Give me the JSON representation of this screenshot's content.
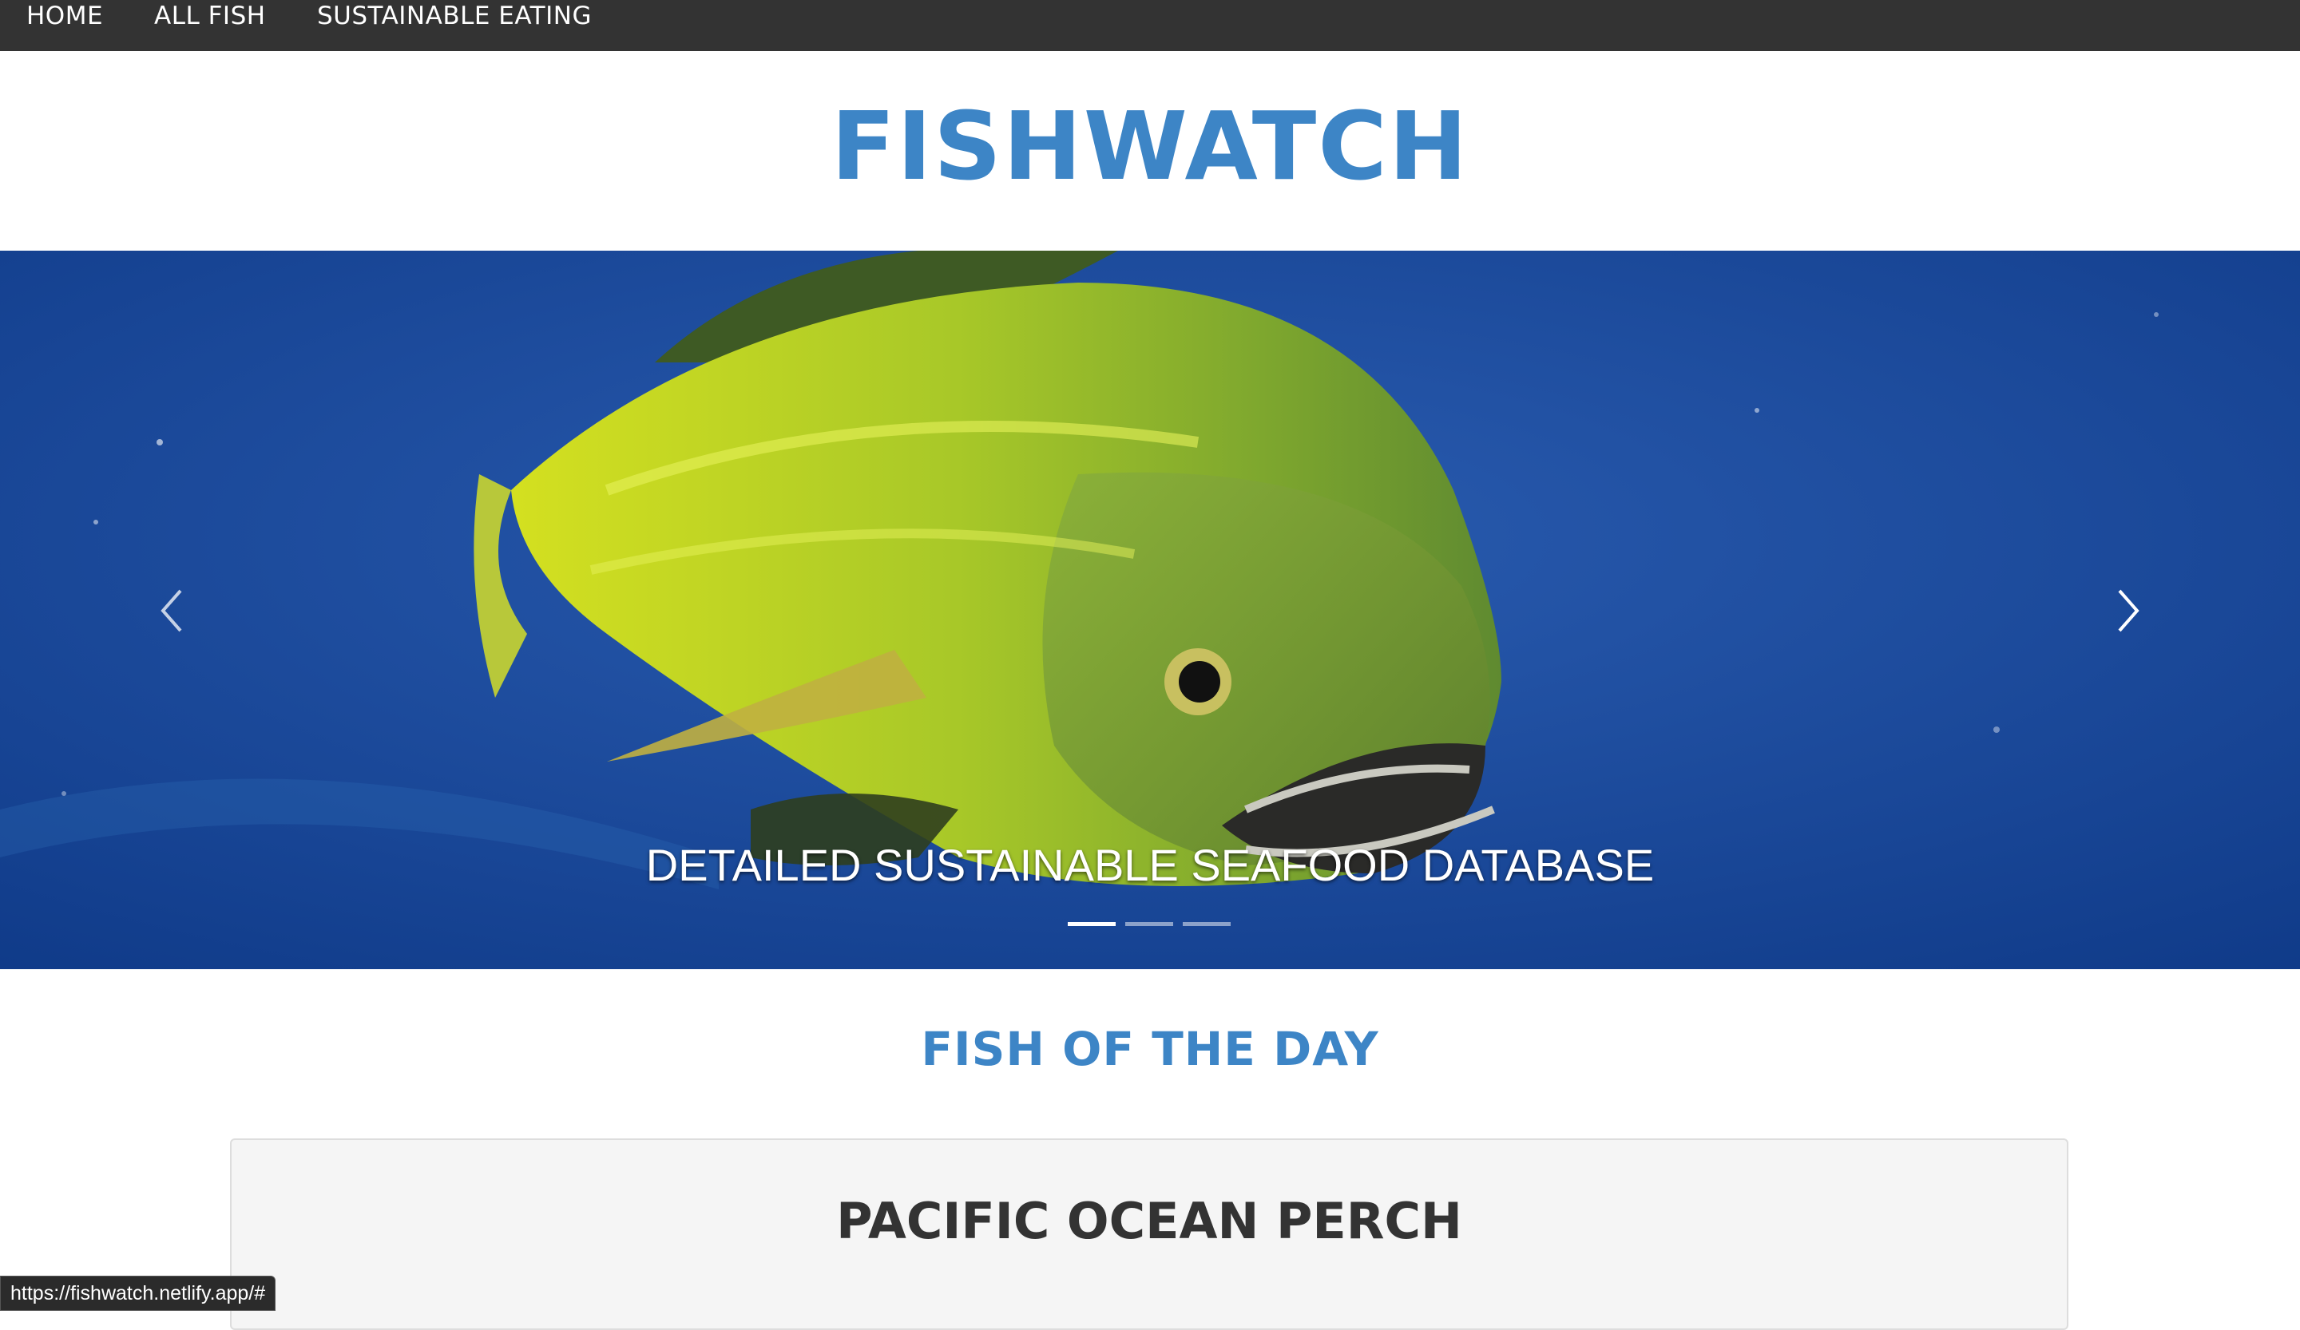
{
  "nav": {
    "home": "HOME",
    "all_fish": "ALL FISH",
    "sustainable_eating": "SUSTAINABLE EATING"
  },
  "header": {
    "title": "FISHWATCH"
  },
  "carousel": {
    "caption": "DETAILED SUSTAINABLE SEAFOOD DATABASE",
    "slide_count": 3,
    "active_slide": 1,
    "image_description_icon": "mahi-mahi-fish-image",
    "prev_icon": "chevron-left-icon",
    "next_icon": "chevron-right-icon"
  },
  "section": {
    "heading": "FISH OF THE DAY"
  },
  "card": {
    "fish_name": "PACIFIC OCEAN PERCH"
  },
  "status_bar": {
    "url": "https://fishwatch.netlify.app/#"
  },
  "colors": {
    "nav_bg": "#333333",
    "accent": "#3d85c6",
    "card_bg": "#f5f5f5",
    "ocean": "#1a4a98"
  }
}
